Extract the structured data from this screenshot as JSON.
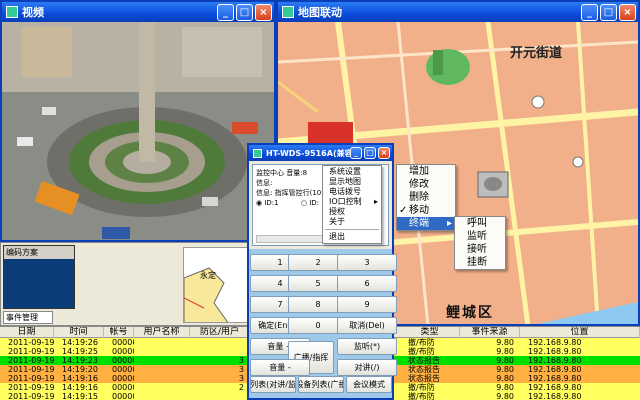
{
  "video_window": {
    "title": "视频"
  },
  "map_window": {
    "title": "地图联动",
    "labels": {
      "street": "开元街道",
      "district": "鲤城区"
    }
  },
  "left_panel": {
    "section_header": "编码方案",
    "tab_label": "事件管理",
    "mini_map_label": "永定"
  },
  "control_window": {
    "title": "HT-WDS-9516A(兼容版)F",
    "info": {
      "line1_label": "监控中心",
      "line1_volume": "音量:8",
      "line2_label": "信息:",
      "line3_label": "信息:",
      "line3_value": "指挥管控行(10)",
      "id_radio_1": "ID:1",
      "id_radio_2": "ID:"
    },
    "keypad": [
      "1",
      "2",
      "3",
      "4",
      "5",
      "6",
      "7",
      "8",
      "9",
      "确定(Enter)",
      "0",
      "取消(Del)"
    ],
    "buttons": {
      "volume_up": "音量 +",
      "volume_down": "音量 -",
      "broadcast": "广播/指挥",
      "monitor": "监听(*)",
      "intercom": "对讲(/)",
      "list_intercom": "列表(对讲/监",
      "list_broadcast": "设备列表(广播",
      "conference": "会议模式"
    }
  },
  "context_menu": {
    "items": [
      "系统设置",
      "显示地图",
      "电话拨号",
      "IO口控制",
      "授权",
      "关于",
      "退出"
    ]
  },
  "map_menu": {
    "items": [
      "增加",
      "修改",
      "删除",
      "移动",
      "终端"
    ],
    "checked": "移动",
    "highlighted": "终端"
  },
  "submenu": {
    "items": [
      "呼叫",
      "监听",
      "接听",
      "挂断"
    ]
  },
  "table": {
    "columns": [
      "日期",
      "时间",
      "帐号",
      "用户名称",
      "防区/用户",
      "类型",
      "事件来源",
      "位置"
    ],
    "rows": [
      {
        "date": "2011-09-19",
        "time": "14:19:26",
        "account": "000000",
        "user": "",
        "zone": "",
        "type": "撤/布防",
        "source": "9.80",
        "location": "192.168.9.80",
        "color": "#ffff60"
      },
      {
        "date": "2011-09-19",
        "time": "14:19:25",
        "account": "000000",
        "user": "",
        "zone": "",
        "type": "撤/布防",
        "source": "9.80",
        "location": "192.168.9.80",
        "color": "#ffff60"
      },
      {
        "date": "2011-09-19",
        "time": "14:19:23",
        "account": "000000",
        "user": "",
        "zone": "3",
        "type": "状态报告",
        "source": "9.80",
        "location": "192.168.9.80",
        "color": "#00e000"
      },
      {
        "date": "2011-09-19",
        "time": "14:19:20",
        "account": "000000",
        "user": "",
        "zone": "3",
        "type": "状态报告",
        "source": "9.80",
        "location": "192.168.9.80",
        "color": "#ffb040"
      },
      {
        "date": "2011-09-19",
        "time": "14:19:16",
        "account": "000000",
        "user": "",
        "zone": "3",
        "type": "状态报告",
        "source": "9.80",
        "location": "192.168.9.80",
        "color": "#ffb040"
      },
      {
        "date": "2011-09-19",
        "time": "14:19:16",
        "account": "000000",
        "user": "",
        "zone": "2",
        "type": "撤/布防",
        "source": "9.80",
        "location": "192.168.9.80",
        "color": "#ffff60"
      },
      {
        "date": "2011-09-19",
        "time": "14:19:15",
        "account": "000000",
        "user": "",
        "zone": "",
        "type": "撤/布防",
        "source": "9.80",
        "location": "192.168.9.80",
        "color": "#ffff60"
      }
    ]
  }
}
